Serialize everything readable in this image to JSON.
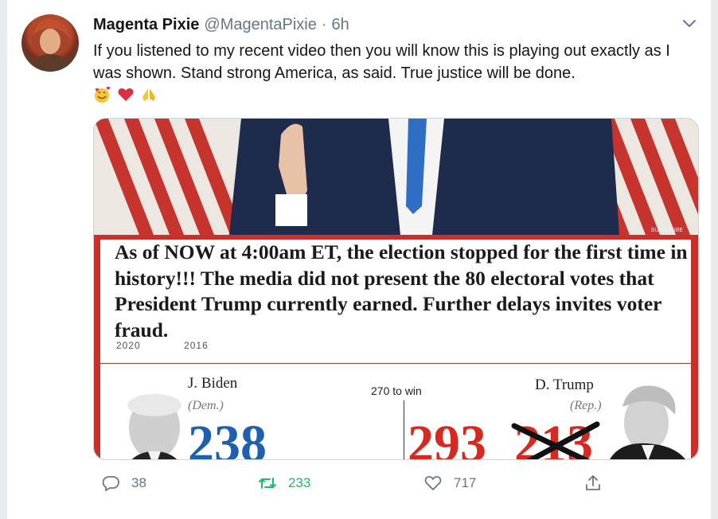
{
  "tweet": {
    "author_name": "Magenta Pixie",
    "handle": "@MagentaPixie",
    "separator": "·",
    "time": "6h",
    "text": "If you listened to my recent video then you will know this is playing out exactly as I was shown. Stand strong America, as said. True justice will be done.",
    "emojis": [
      "smiling-face-with-hearts-icon",
      "red-heart-icon",
      "folded-hands-icon"
    ]
  },
  "media": {
    "caption": "As of NOW at 4:00am ET, the election stopped for the first time in history!!! The media did not present the 80 electoral votes that President Trump currently earned. Further delays invites voter fraud.",
    "watermark": "SUBSCRIBE",
    "years": [
      "2020",
      "2016"
    ],
    "left_candidate": {
      "name": "J. Biden",
      "party": "(Dem.)",
      "votes": "238"
    },
    "threshold": "270 to win",
    "right_candidate": {
      "name": "D. Trump",
      "party": "(Rep.)",
      "votes": "293",
      "crossed_votes": "213"
    },
    "colors": {
      "dem_blue": "#1f5fb0",
      "rep_red": "#d6291f",
      "stripe_red": "#c9302c"
    }
  },
  "actions": {
    "replies": "38",
    "retweets": "233",
    "likes": "717",
    "colors": {
      "retweet_green": "#17bf63",
      "default_gray": "#657786"
    }
  }
}
